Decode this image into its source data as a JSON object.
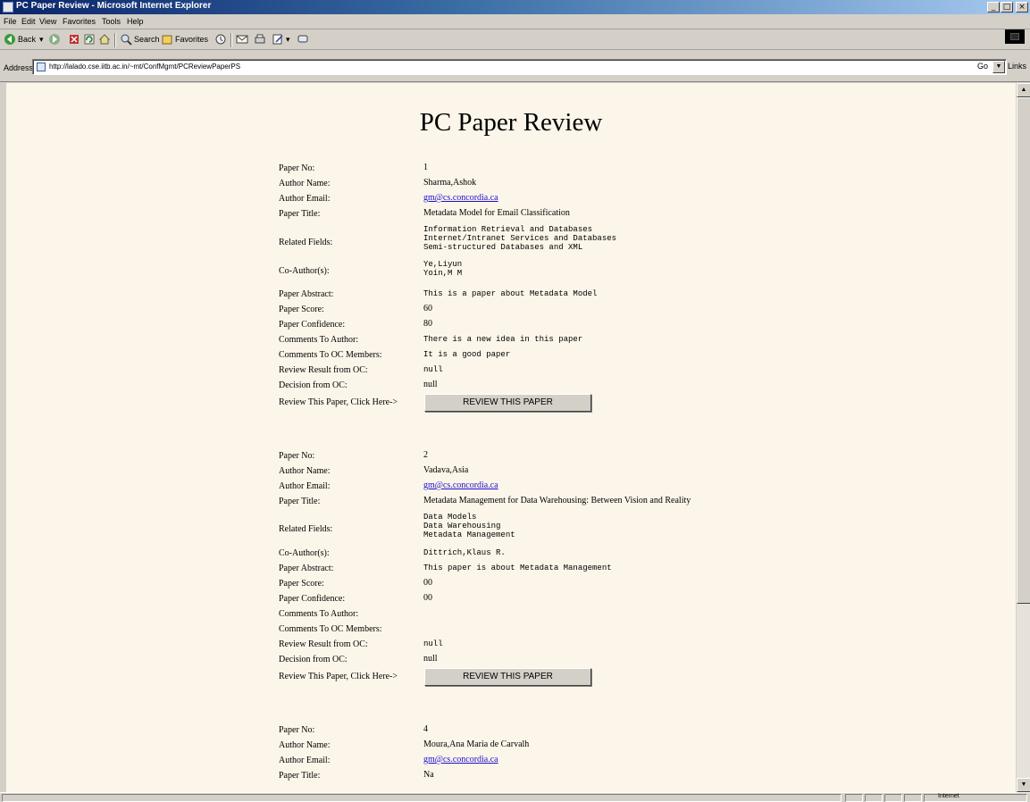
{
  "window": {
    "title": "PC Paper Review - Microsoft Internet Explorer",
    "buttons": [
      "_",
      "□",
      "×"
    ]
  },
  "menu": [
    "File",
    "Edit",
    "View",
    "Favorites",
    "Tools",
    "Help"
  ],
  "toolbar": {
    "back": "Back",
    "search": "Search",
    "favorites": "Favorites",
    "icons": [
      "back-icon",
      "forward-icon",
      "stop-icon",
      "refresh-icon",
      "home-icon",
      "search-icon",
      "favorites-icon",
      "history-icon",
      "mail-icon",
      "print-icon",
      "edit-icon",
      "discuss-icon"
    ]
  },
  "address": {
    "label": "Address",
    "url": "http://lalado.cse.iitb.ac.in/~mt/ConfMgmt/PCReviewPaperPS",
    "go": "Go",
    "links": "Links"
  },
  "page": {
    "title": "PC Paper Review",
    "labels": {
      "paper_no": "Paper No:",
      "author_name": "Author Name:",
      "author_email": "Author Email:",
      "paper_title": "Paper Title:",
      "related_fields": "Related Fields:",
      "co_authors": "Co-Author(s):",
      "paper_abstract": "Paper Abstract:",
      "paper_score": "Paper Score:",
      "paper_confidence": "Paper Confidence:",
      "comments_author": "Comments To Author:",
      "comments_pc": "Comments To OC Members:",
      "review_result": "Review Result from OC:",
      "decision": "Decision from OC:",
      "review_prompt": "Review This Paper, Click Here->"
    },
    "review_button": "REVIEW THIS PAPER",
    "papers": [
      {
        "paper_no": "1",
        "author_name": "Sharma,Ashok",
        "author_email": "gm@cs.concordia.ca",
        "paper_title": "Metadata Model for Email Classification",
        "related_fields": [
          "Information Retrieval and Databases",
          "Internet/Intranet Services and Databases",
          "Semi-structured Databases and XML"
        ],
        "co_authors": [
          "Ye,Liyun",
          "Yoin,M M"
        ],
        "paper_abstract": "This is a paper about Metadata Model",
        "paper_score": "60",
        "paper_confidence": "80",
        "comments_author": "There is a new idea in this paper",
        "comments_pc": "It is a good paper",
        "review_result": "null",
        "decision": "null"
      },
      {
        "paper_no": "2",
        "author_name": "Vadava,Asia",
        "author_email": "gm@cs.concordia.ca",
        "paper_title": "Metadata Management for Data Warehousing: Between Vision and Reality",
        "related_fields": [
          "Data Models",
          "Data Warehousing",
          "Metadata Management"
        ],
        "co_authors": [
          "Dittrich,Klaus R."
        ],
        "paper_abstract": "This paper is about Metadata Management",
        "paper_score": "00",
        "paper_confidence": "00",
        "comments_author": "",
        "comments_pc": "",
        "review_result": "null",
        "decision": "null"
      },
      {
        "paper_no": "4",
        "author_name": "Moura,Ana Maria de Carvalh",
        "author_email": "gm@cs.concordia.ca",
        "paper_title": "Na"
      }
    ]
  },
  "status": {
    "zone": "Internet"
  }
}
